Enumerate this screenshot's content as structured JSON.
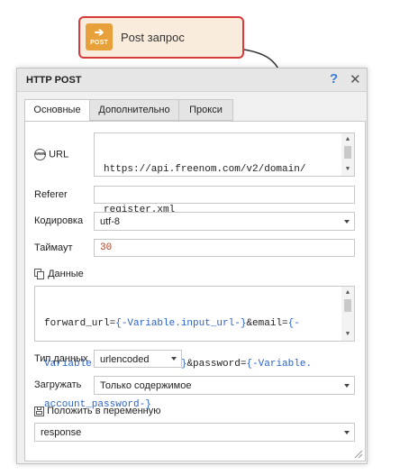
{
  "node": {
    "icon_label": "POST",
    "icon_arrow": "➔",
    "title": "Post запрос"
  },
  "dialog": {
    "title": "HTTP POST",
    "help": "?",
    "close": "✕"
  },
  "tabs": [
    {
      "label": "Основные",
      "active": true
    },
    {
      "label": "Дополнительно",
      "active": false
    },
    {
      "label": "Прокси",
      "active": false
    }
  ],
  "form": {
    "url": {
      "label": "URL",
      "icon_text": "www",
      "lines": [
        "https://api.freenom.com/v2/domain/",
        "register.xml"
      ]
    },
    "referer": {
      "label": "Referer",
      "value": ""
    },
    "encoding": {
      "label": "Кодировка",
      "value": "utf-8"
    },
    "timeout": {
      "label": "Таймаут",
      "value": "30"
    },
    "data": {
      "label": "Данные",
      "line1": {
        "pre": "forward_url=",
        "var1": "{-Variable.input_url-}",
        "mid": "&email=",
        "var2": "{-"
      },
      "line2": {
        "var": "Variable.account_email-}",
        "mid": "&password=",
        "var2": "{-Variable."
      },
      "line3": {
        "var": "account_password-}"
      }
    },
    "data_type": {
      "label": "Тип данных",
      "value": "urlencoded"
    },
    "load": {
      "label": "Загружать",
      "value": "Только содержимое"
    },
    "save_to": {
      "label": "Положить в переменную",
      "value": "response"
    }
  }
}
